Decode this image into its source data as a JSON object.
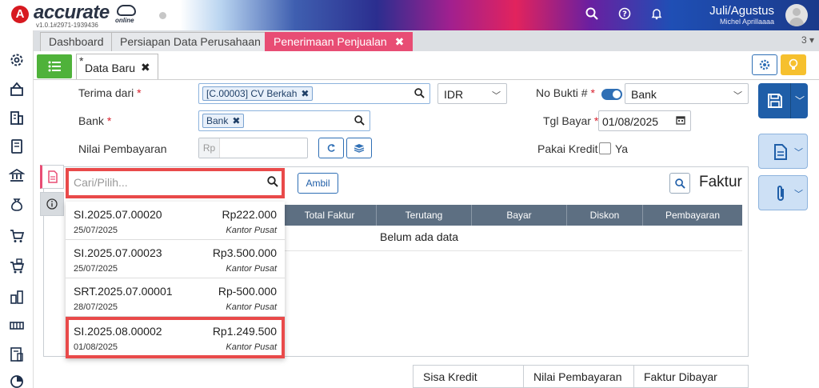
{
  "header": {
    "logo_mark": "A",
    "logo_text": "accurate",
    "logo_suffix": "online",
    "version": "v1.0.1#2971-1939436",
    "period": "Juli/Agustus",
    "user": "Michel Aprillaaaa"
  },
  "tabs": [
    {
      "label": "Dashboard"
    },
    {
      "label": "Persiapan Data Perusahaan"
    },
    {
      "label": "Penerimaan Penjualan",
      "close": "✖"
    }
  ],
  "tab_count": "3",
  "doc_tab": {
    "star": "*",
    "label": "Data Baru",
    "close": "✖"
  },
  "form": {
    "terima_dari_label": "Terima dari",
    "terima_dari_chip": "[C.00003] CV Berkah",
    "currency": "IDR",
    "no_bukti_label": "No Bukti #",
    "no_bukti_value": "Bank",
    "bank_label": "Bank",
    "bank_chip": "Bank",
    "tgl_bayar_label": "Tgl Bayar",
    "tgl_bayar_value": "01/08/2025",
    "nilai_label": "Nilai Pembayaran",
    "nilai_prefix": "Rp",
    "pakai_kredit_label": "Pakai Kredit",
    "pakai_kredit_option": "Ya",
    "required_mark": "*"
  },
  "detail": {
    "search_placeholder": "Cari/Pilih...",
    "ambil_label": "Ambil",
    "faktur_title": "Faktur",
    "columns": [
      "Total Faktur",
      "Terutang",
      "Bayar",
      "Diskon",
      "Pembayaran"
    ],
    "empty_text": "Belum ada data"
  },
  "dropdown": [
    {
      "number": "SI.2025.07.00020",
      "amount": "Rp222.000",
      "date": "25/07/2025",
      "office": "Kantor Pusat"
    },
    {
      "number": "SI.2025.07.00023",
      "amount": "Rp3.500.000",
      "date": "25/07/2025",
      "office": "Kantor Pusat"
    },
    {
      "number": "SRT.2025.07.00001",
      "amount": "Rp-500.000",
      "date": "28/07/2025",
      "office": "Kantor Pusat"
    },
    {
      "number": "SI.2025.08.00002",
      "amount": "Rp1.249.500",
      "date": "01/08/2025",
      "office": "Kantor Pusat"
    }
  ],
  "footer": {
    "sisa_kredit": "Sisa Kredit",
    "nilai_pembayaran": "Nilai Pembayaran",
    "faktur_dibayar": "Faktur Dibayar"
  },
  "colors": {
    "active_tab": "#e84d74",
    "primary": "#1f5ea8",
    "highlight": "#e94a4a",
    "list_button": "#4fb23a"
  }
}
